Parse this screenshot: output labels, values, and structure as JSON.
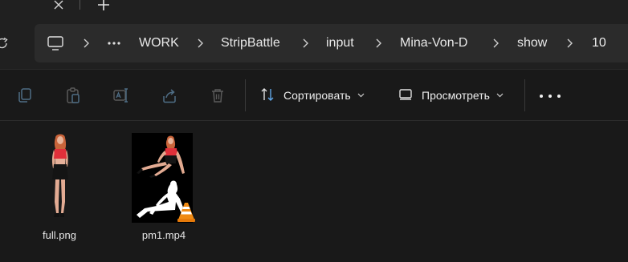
{
  "breadcrumb": {
    "items": [
      "WORK",
      "StripBattle",
      "input",
      "Mina-Von-D",
      "show",
      "10"
    ]
  },
  "toolbar": {
    "sort_label": "Сортировать",
    "view_label": "Просмотреть"
  },
  "files": [
    {
      "name": "full.png",
      "type": "image"
    },
    {
      "name": "pm1.mp4",
      "type": "video"
    }
  ],
  "icons": {
    "tab_close": "close-icon",
    "tab_add": "plus-icon",
    "refresh": "refresh-icon",
    "this_pc": "monitor-icon",
    "overflow": "more-horizontal-icon",
    "copy": "copy-icon",
    "paste": "paste-icon",
    "rename": "rename-icon",
    "share": "share-icon",
    "delete": "trash-icon",
    "sort": "sort-icon",
    "view": "view-icon",
    "more": "more-icon",
    "vlc_badge": "vlc-cone-icon"
  },
  "colors": {
    "background": "#191919",
    "chrome": "#202020",
    "addressbar": "#2b2b2b",
    "text": "#e9e9e9",
    "icon_disabled": "#5a7a94",
    "accent": "#60a5e6",
    "shirt_red": "#e0303a"
  }
}
